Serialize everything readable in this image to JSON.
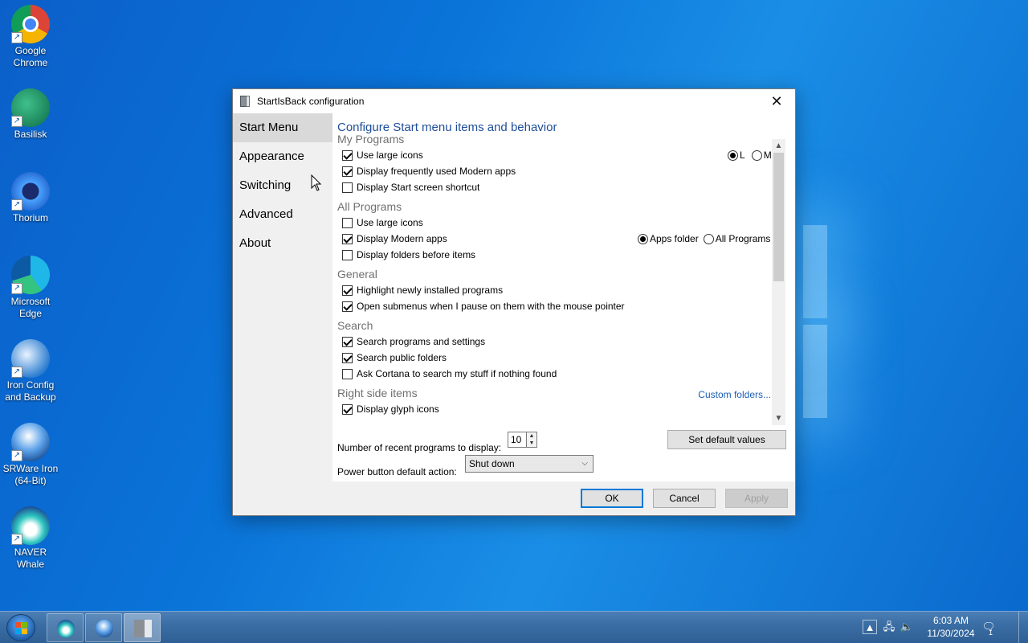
{
  "desktop": {
    "icons": [
      {
        "label": "Google Chrome",
        "icon": "chrome-icon"
      },
      {
        "label": "Basilisk",
        "icon": "basilisk-icon"
      },
      {
        "label": "Thorium",
        "icon": "thorium-icon"
      },
      {
        "label": "Microsoft Edge",
        "icon": "edge-icon"
      },
      {
        "label": "Iron Config and Backup",
        "icon": "iron-config-icon"
      },
      {
        "label": "SRWare Iron (64-Bit)",
        "icon": "srware-iron-icon"
      },
      {
        "label": "NAVER Whale",
        "icon": "naver-whale-icon"
      }
    ]
  },
  "dialog": {
    "title": "StartIsBack configuration",
    "close_glyph": "✕",
    "nav": [
      "Start Menu",
      "Appearance",
      "Switching",
      "Advanced",
      "About"
    ],
    "heading": "Configure Start menu items and behavior",
    "sections": {
      "my_programs": "My Programs",
      "all_programs": "All Programs",
      "general": "General",
      "search": "Search",
      "right_side": "Right side items"
    },
    "options": {
      "mp_large_icons": {
        "label": "Use large icons",
        "checked": true
      },
      "mp_modern_apps": {
        "label": "Display frequently used Modern apps",
        "checked": true
      },
      "mp_start_screen": {
        "label": "Display Start screen shortcut",
        "checked": false
      },
      "ap_large_icons": {
        "label": "Use large icons",
        "checked": false
      },
      "ap_modern_apps": {
        "label": "Display Modern apps",
        "checked": true
      },
      "ap_folders_first": {
        "label": "Display folders before items",
        "checked": false
      },
      "gen_highlight": {
        "label": "Highlight newly installed programs",
        "checked": true
      },
      "gen_submenus": {
        "label": "Open submenus when I pause on them with the mouse pointer",
        "checked": true
      },
      "srch_programs": {
        "label": "Search programs and settings",
        "checked": true
      },
      "srch_public": {
        "label": "Search public folders",
        "checked": true
      },
      "srch_cortana": {
        "label": "Ask Cortana to search my stuff if nothing found",
        "checked": false
      },
      "rs_glyph": {
        "label": "Display glyph icons",
        "checked": true
      }
    },
    "size_radio": {
      "l": "L",
      "m": "M",
      "selected": "L"
    },
    "modern_radio": {
      "apps_folder": "Apps folder",
      "all_programs": "All Programs",
      "selected": "Apps folder"
    },
    "custom_folders_link": "Custom folders...",
    "recent_label": "Number of recent programs to display:",
    "recent_value": "10",
    "set_default_button": "Set default values",
    "power_label": "Power button default action:",
    "power_value": "Shut down",
    "ok_button": "OK",
    "cancel_button": "Cancel",
    "apply_button": "Apply"
  },
  "taskbar": {
    "time": "6:03 AM",
    "date": "11/30/2024",
    "notification_count": "1"
  },
  "colors": {
    "accent": "#0078d7",
    "heading": "#1f4e9a",
    "link": "#1a5fb4",
    "section": "#707070"
  }
}
